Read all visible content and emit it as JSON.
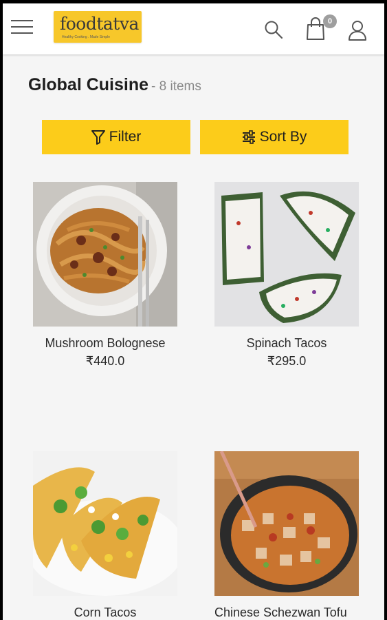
{
  "header": {
    "logo_text": "foodtatva",
    "logo_tagline": "Healthy Cooking . Made Simple",
    "cart_count": "0"
  },
  "page": {
    "title": "Global Cuisine",
    "item_count": "- 8 items"
  },
  "actions": {
    "filter_label": "Filter",
    "sort_label": "Sort By"
  },
  "colors": {
    "accent": "#fccc1a",
    "logo_bg": "#f7c72a",
    "badge": "#9e9e9e"
  },
  "products": [
    {
      "name": "Mushroom Bolognese",
      "price": "₹440.0",
      "image": "mushroom-bolognese-photo"
    },
    {
      "name": "Spinach Tacos",
      "price": "₹295.0",
      "image": "spinach-tacos-photo"
    },
    {
      "name": "Corn Tacos",
      "price": "",
      "image": "corn-tacos-photo"
    },
    {
      "name": "Chinese Schezwan Tofu",
      "price": "",
      "image": "schezwan-tofu-photo"
    }
  ]
}
